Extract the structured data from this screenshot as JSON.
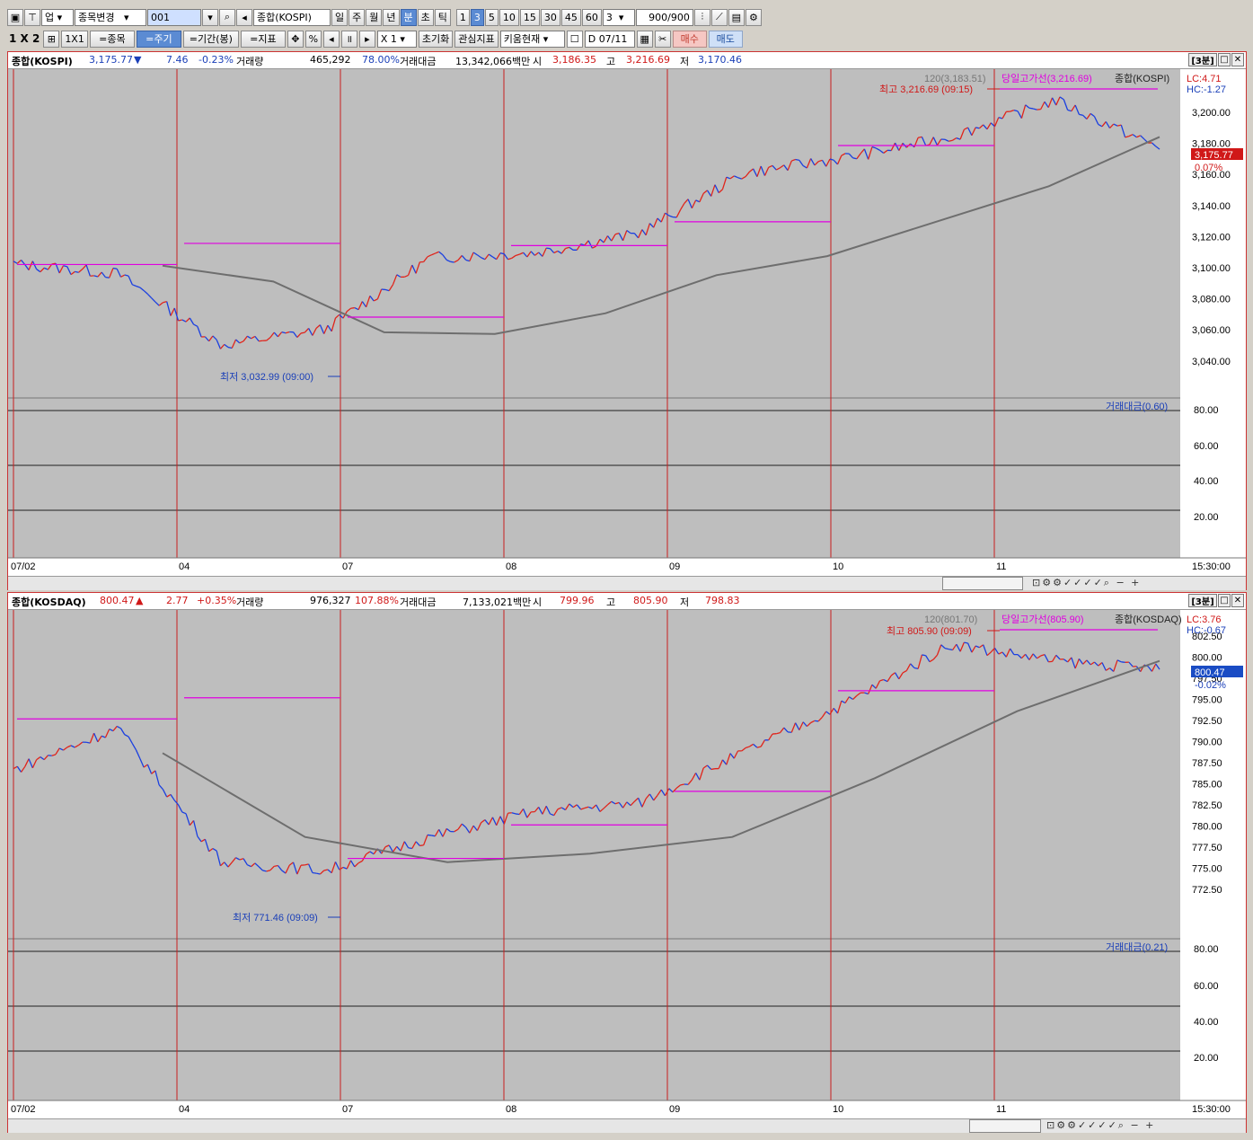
{
  "toolbar1": {
    "market": "업",
    "stock_change": "종목변경",
    "code": "001",
    "index_name": "종합(KOSPI)",
    "period_buttons": [
      "일",
      "주",
      "월",
      "년",
      "분",
      "초",
      "틱"
    ],
    "interval_buttons": [
      "1",
      "3",
      "5",
      "10",
      "15",
      "30",
      "45",
      "60"
    ],
    "interval_value": "3",
    "count": "900",
    "count_total": "/900"
  },
  "toolbar2": {
    "layout_label": "1 X 2",
    "one_by_one": "1X1",
    "eq_stock": "=종목",
    "eq_period": "=주기",
    "eq_range": "=기간(봉)",
    "eq_indicator": "=지표",
    "percent": "%",
    "zoom": "X 1",
    "reset": "초기화",
    "watch": "관심지표",
    "kiwoom": "키움현재",
    "date": "07/11",
    "buy": "매수",
    "sell": "매도"
  },
  "colors": {
    "up": "#e0241b",
    "down": "#1a3fe0",
    "ref": "#e000e0",
    "ma": "#6e6e6e",
    "grid": "#c81e1e",
    "panel_bg": "#bebebe"
  },
  "panels": [
    {
      "name": "종합(KOSPI)",
      "price": "3,175.77",
      "arrow": "▼",
      "change": "7.46",
      "change_pct": "-0.23%",
      "vol_label": "거래량",
      "volume": "465,292",
      "vol_pct": "78.00%",
      "amt_label": "거래대금",
      "amount": "13,342,066백만",
      "open_label": "시",
      "open": "3,186.35",
      "high_label": "고",
      "high": "3,216.69",
      "low_label": "저",
      "low": "3,170.46",
      "timeframe": "[3분]",
      "legend_ma": "120(3,183.51)",
      "legend_ref": "당일고가선(3,216.69)",
      "legend_name": "종합(KOSPI)",
      "lc": "LC:4.71",
      "hc": "HC:-1.27",
      "last_tag": "3,175.77",
      "last_pct": "0.07%",
      "max_label": "최고 3,216.69 (09:15)",
      "min_label": "최저 3,032.99 (09:00)",
      "sub_legend": "거래대금(0.60)",
      "y_ticks": [
        "3,200.00",
        "3,180.00",
        "3,160.00",
        "3,140.00",
        "3,120.00",
        "3,100.00",
        "3,080.00",
        "3,060.00",
        "3,040.00"
      ],
      "sub_ticks": [
        "80.00",
        "60.00",
        "40.00",
        "20.00"
      ],
      "date_labels": [
        "07/02",
        "04",
        "07",
        "08",
        "09",
        "10",
        "11"
      ],
      "time_label": "15:30:00"
    },
    {
      "name": "종합(KOSDAQ)",
      "price": "800.47",
      "arrow": "▲",
      "change": "2.77",
      "change_pct": "+0.35%",
      "vol_label": "거래량",
      "volume": "976,327",
      "vol_pct": "107.88%",
      "amt_label": "거래대금",
      "amount": "7,133,021백만",
      "open_label": "시",
      "open": "799.96",
      "high_label": "고",
      "high": "805.90",
      "low_label": "저",
      "low": "798.83",
      "timeframe": "[3분]",
      "legend_ma": "120(801.70)",
      "legend_ref": "당일고가선(805.90)",
      "legend_name": "종합(KOSDAQ)",
      "lc": "LC:3.76",
      "hc": "HC:-0.67",
      "last_tag": "800.47",
      "last_pct": "-0.02%",
      "max_label": "최고 805.90 (09:09)",
      "min_label": "최저 771.46 (09:09)",
      "sub_legend": "거래대금(0.21)",
      "y_ticks": [
        "802.50",
        "800.00",
        "797.50",
        "795.00",
        "792.50",
        "790.00",
        "787.50",
        "785.00",
        "782.50",
        "780.00",
        "777.50",
        "775.00",
        "772.50"
      ],
      "sub_ticks": [
        "80.00",
        "60.00",
        "40.00",
        "20.00"
      ],
      "date_labels": [
        "07/02",
        "04",
        "07",
        "08",
        "09",
        "10",
        "11"
      ],
      "time_label": "15:30:00"
    }
  ],
  "chart_data": [
    {
      "type": "line",
      "title": "종합(KOSPI)",
      "x": [
        "07/02",
        "04",
        "07",
        "08",
        "09",
        "10",
        "11"
      ],
      "series": [
        {
          "name": "종합(KOSPI)",
          "values": [
            3103,
            3097,
            3052,
            3062,
            3107,
            3110,
            3122,
            3160,
            3170,
            3183,
            3206,
            3176
          ]
        },
        {
          "name": "120(3,183.51)",
          "values": [
            3102,
            3092,
            3060,
            3059,
            3072,
            3096,
            3108,
            3130,
            3152,
            3183
          ]
        }
      ],
      "ylim": [
        3030,
        3220
      ]
    },
    {
      "type": "line",
      "title": "종합(KOSDAQ)",
      "x": [
        "07/02",
        "04",
        "07",
        "08",
        "09",
        "10",
        "11"
      ],
      "series": [
        {
          "name": "종합(KOSDAQ)",
          "values": [
            788,
            793,
            777,
            776,
            780,
            783,
            784,
            790,
            796,
            803,
            801,
            800
          ]
        },
        {
          "name": "120(801.70)",
          "values": [
            790,
            780,
            777,
            778,
            780,
            787,
            795,
            801
          ]
        }
      ],
      "ylim": [
        770,
        806
      ]
    }
  ]
}
